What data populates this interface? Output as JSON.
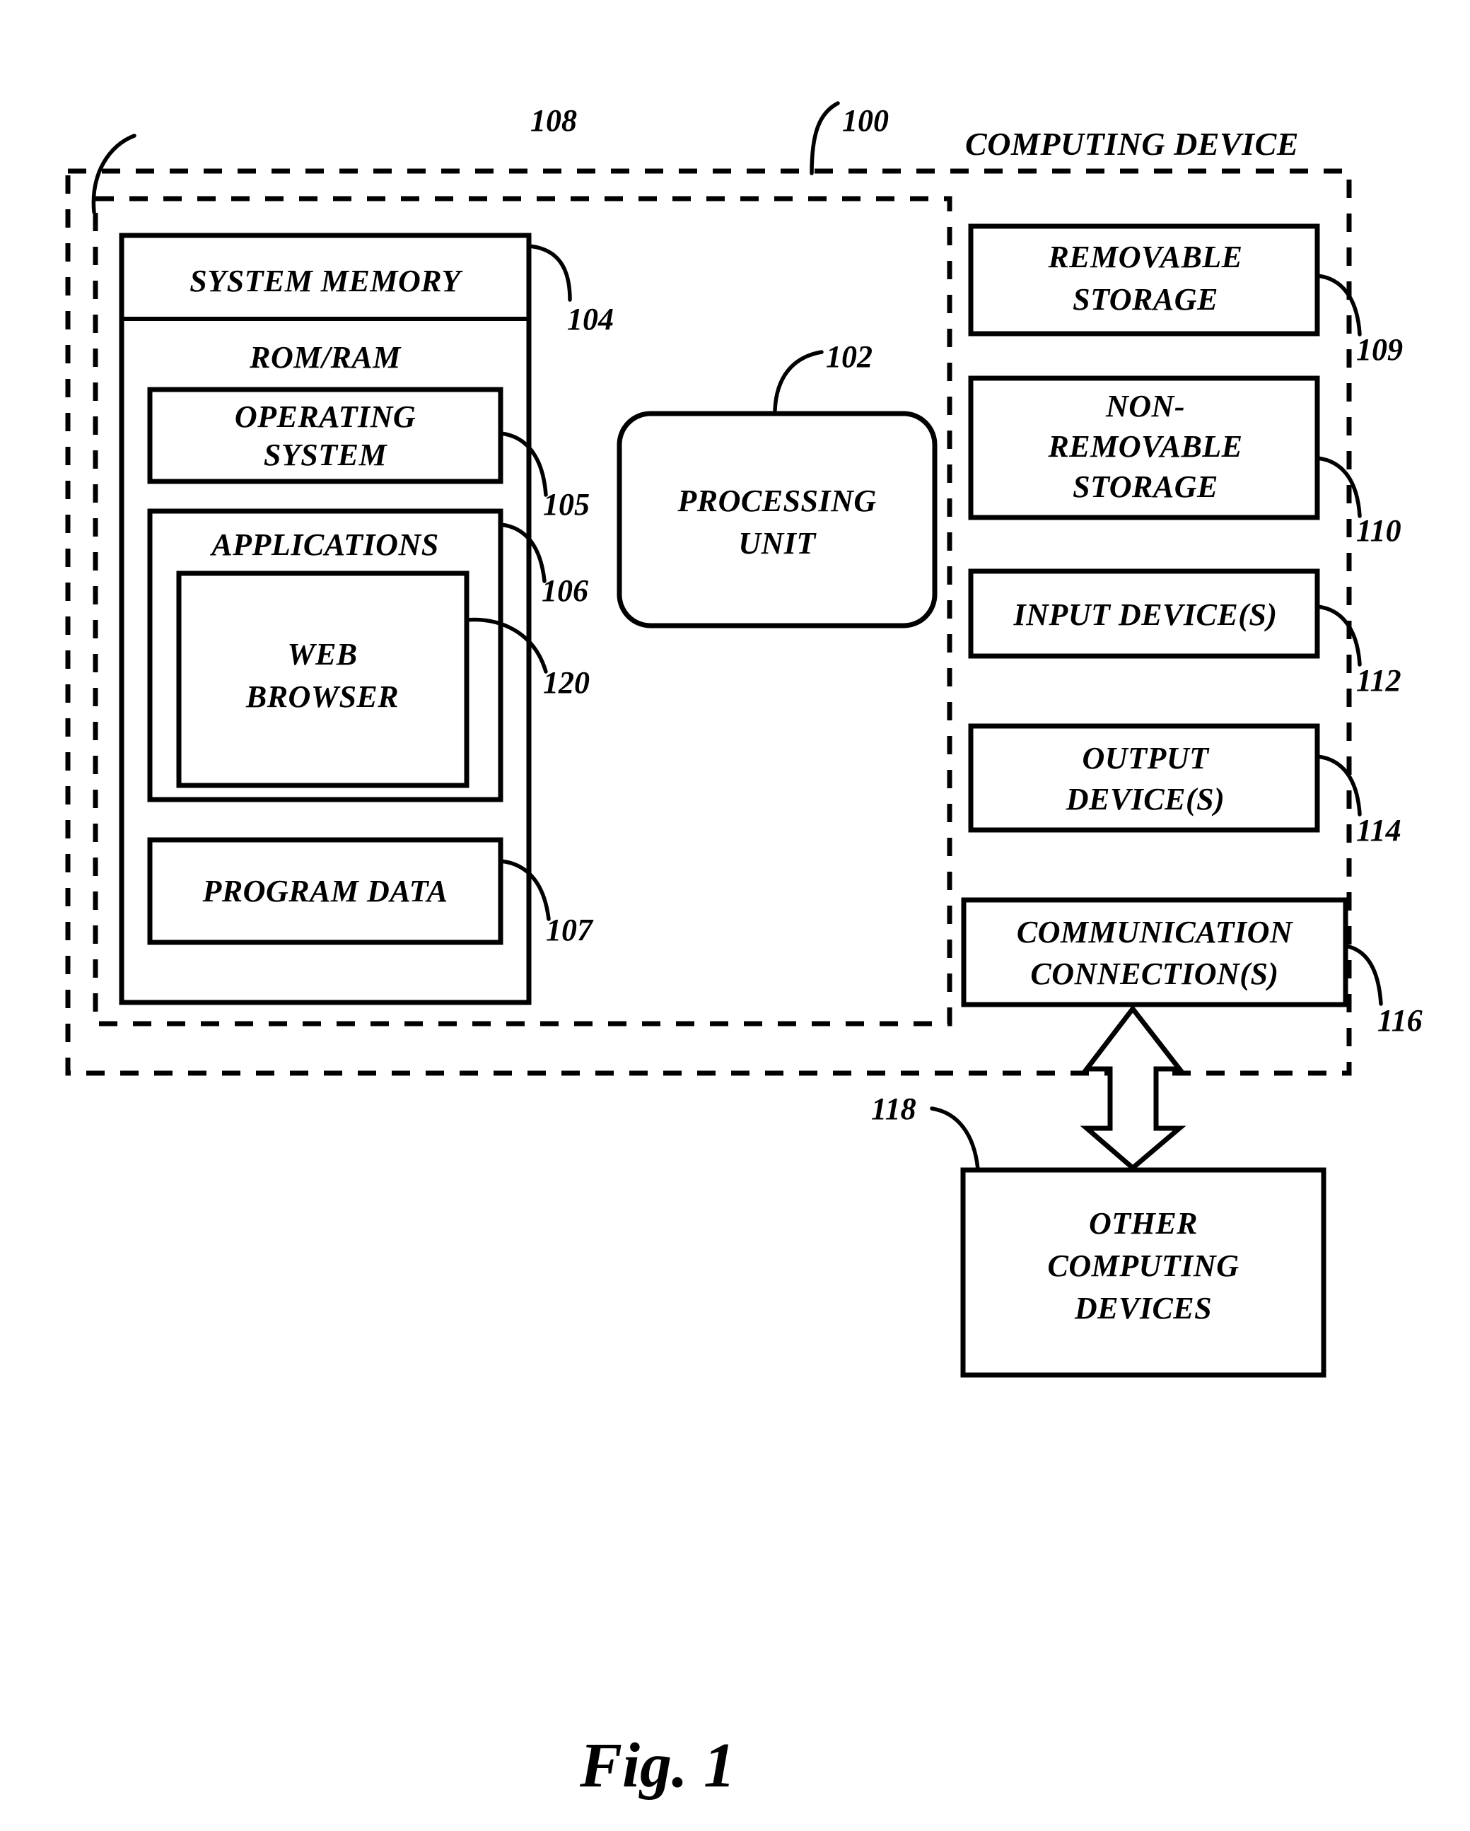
{
  "figure": {
    "caption": "Fig. 1",
    "title": "COMPUTING DEVICE"
  },
  "reference_numerals": {
    "device": "100",
    "processing_unit": "102",
    "system_memory": "104",
    "operating_system": "105",
    "applications": "106",
    "program_data": "107",
    "basic_configuration": "108",
    "removable_storage": "109",
    "non_removable_storage": "110",
    "input_devices": "112",
    "output_devices": "114",
    "communication_connections": "116",
    "other_computing_devices": "118",
    "web_browser": "120"
  },
  "boxes": {
    "system_memory": "SYSTEM MEMORY",
    "rom_ram": "ROM/RAM",
    "operating_system_line1": "OPERATING",
    "operating_system_line2": "SYSTEM",
    "applications": "APPLICATIONS",
    "web_browser_line1": "WEB",
    "web_browser_line2": "BROWSER",
    "program_data": "PROGRAM DATA",
    "processing_unit_line1": "PROCESSING",
    "processing_unit_line2": "UNIT",
    "removable_storage_line1": "REMOVABLE",
    "removable_storage_line2": "STORAGE",
    "non_removable_storage_line1": "NON-",
    "non_removable_storage_line2": "REMOVABLE",
    "non_removable_storage_line3": "STORAGE",
    "input_devices": "INPUT DEVICE(S)",
    "output_devices_line1": "OUTPUT",
    "output_devices_line2": "DEVICE(S)",
    "communication_line1": "COMMUNICATION",
    "communication_line2": "CONNECTION(S)",
    "other_computing_line1": "OTHER",
    "other_computing_line2": "COMPUTING",
    "other_computing_line3": "DEVICES"
  },
  "colors": {
    "stroke": "#000000",
    "background": "#ffffff"
  }
}
